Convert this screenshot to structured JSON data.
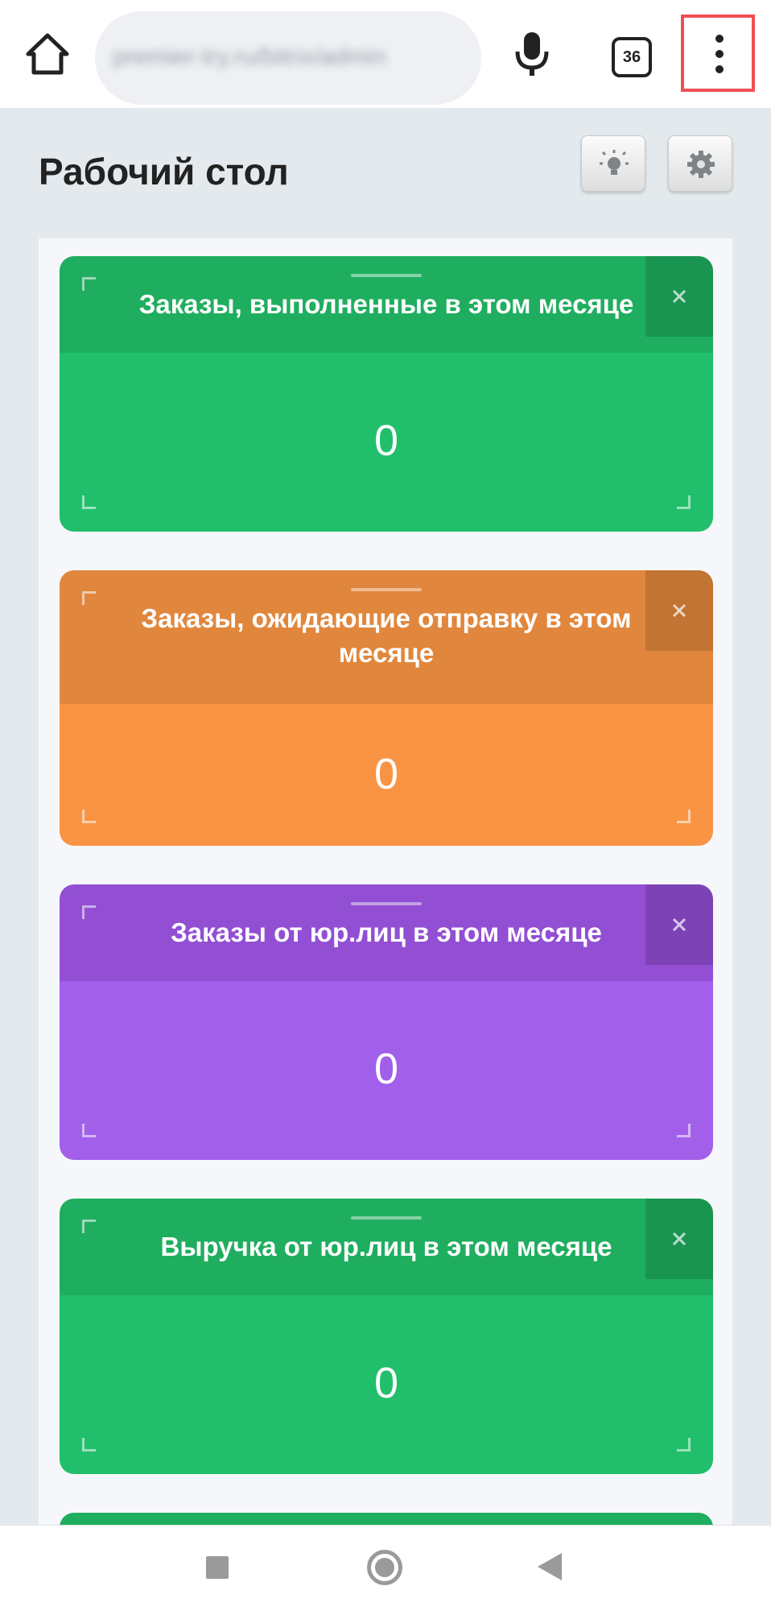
{
  "browser": {
    "url": "premier-try.ru/bitrix/admin",
    "tab_count": "36"
  },
  "page": {
    "title": "Рабочий стол"
  },
  "colors": {
    "green_head": "#1fae5f",
    "green_body": "#21bf6b",
    "orange_head": "#e1873d",
    "orange_body": "#f99444",
    "purple_head": "#924fd4",
    "purple_body": "#a25fea"
  },
  "widgets": [
    {
      "title": "Заказы, выполненные в этом месяце",
      "value": "0",
      "color": "green"
    },
    {
      "title": "Заказы, ожидающие отправку в этом месяце",
      "value": "0",
      "color": "orange"
    },
    {
      "title": "Заказы от юр.лиц в этом месяце",
      "value": "0",
      "color": "purple"
    },
    {
      "title": "Выручка от юр.лиц в этом месяце",
      "value": "0",
      "color": "green"
    }
  ],
  "icons": {
    "home": "home-icon",
    "mic": "mic-icon",
    "menu": "more-vert-icon",
    "bulb": "lightbulb-icon",
    "settings": "gear-icon",
    "close": "close-icon"
  }
}
